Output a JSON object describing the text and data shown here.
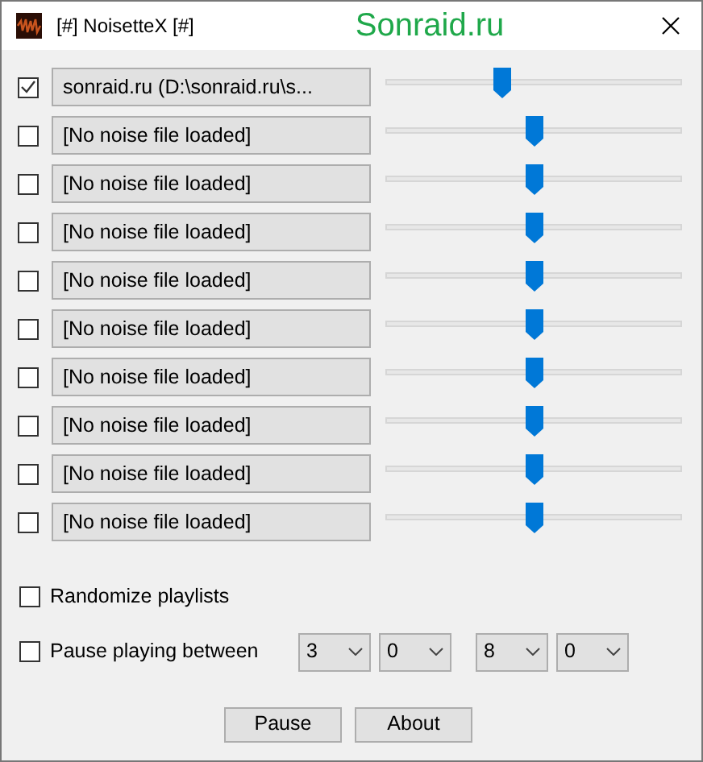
{
  "window": {
    "title": "[#] NoisetteX [#]",
    "watermark": "Sonraid.ru"
  },
  "channels": [
    {
      "checked": true,
      "file": "sonraid.ru (D:\\sonraid.ru\\s...",
      "level": 0.39
    },
    {
      "checked": false,
      "file": "[No noise file loaded]",
      "level": 0.5
    },
    {
      "checked": false,
      "file": "[No noise file loaded]",
      "level": 0.5
    },
    {
      "checked": false,
      "file": "[No noise file loaded]",
      "level": 0.5
    },
    {
      "checked": false,
      "file": "[No noise file loaded]",
      "level": 0.5
    },
    {
      "checked": false,
      "file": "[No noise file loaded]",
      "level": 0.5
    },
    {
      "checked": false,
      "file": "[No noise file loaded]",
      "level": 0.5
    },
    {
      "checked": false,
      "file": "[No noise file loaded]",
      "level": 0.5
    },
    {
      "checked": false,
      "file": "[No noise file loaded]",
      "level": 0.5
    },
    {
      "checked": false,
      "file": "[No noise file loaded]",
      "level": 0.5
    }
  ],
  "randomize": {
    "label": "Randomize playlists",
    "checked": false
  },
  "pause_between": {
    "label": "Pause playing between",
    "checked": false,
    "selects": [
      "3",
      "0",
      "8",
      "0"
    ]
  },
  "buttons": [
    "Pause",
    "About"
  ]
}
